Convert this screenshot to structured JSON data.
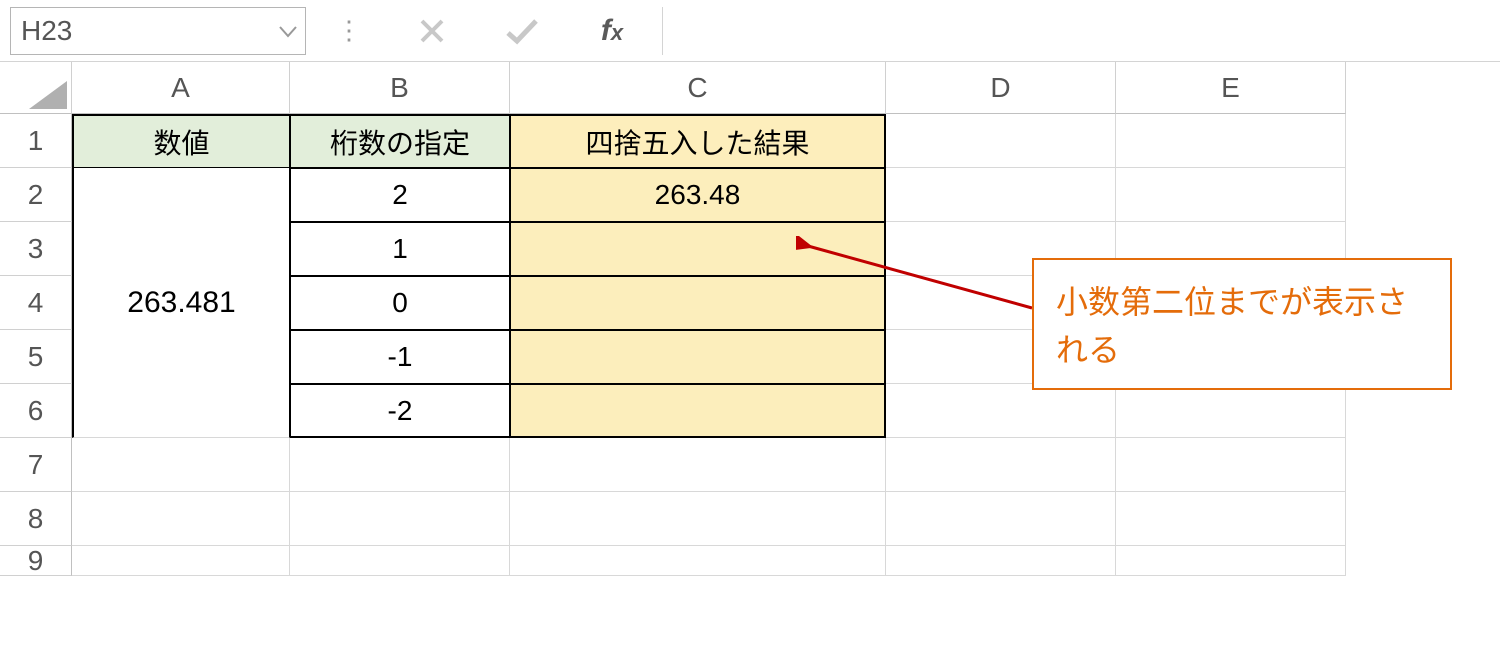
{
  "nameBox": "H23",
  "formulaInput": "",
  "columns": [
    "A",
    "B",
    "C",
    "D",
    "E"
  ],
  "rows": [
    "1",
    "2",
    "3",
    "4",
    "5",
    "6",
    "7",
    "8",
    "9"
  ],
  "headers": {
    "A": "数値",
    "B": "桁数の指定",
    "C": "四捨五入した結果"
  },
  "mergedA": "263.481",
  "bValues": [
    "2",
    "1",
    "0",
    "-1",
    "-2"
  ],
  "cValues": [
    "263.48",
    "",
    "",
    "",
    ""
  ],
  "callout": "小数第二位までが表示される"
}
